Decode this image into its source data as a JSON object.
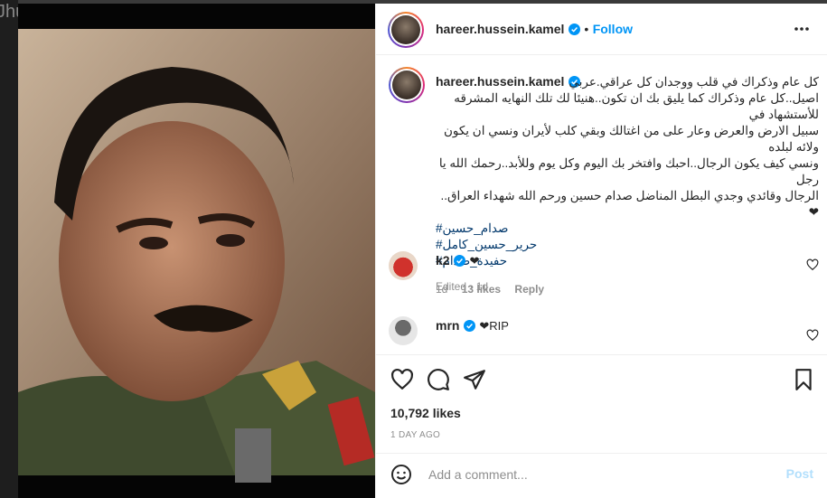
{
  "colors": {
    "accent": "#0095f6",
    "hashtag": "#00376b",
    "muted": "#8e8e8e",
    "post_disabled": "#b2dffc"
  },
  "background": {
    "partial_text": "Jhut"
  },
  "header": {
    "username": "hareer.hussein.kamel",
    "separator": "•",
    "follow_label": "Follow",
    "more_icon": "more-horizontal-icon"
  },
  "caption": {
    "username": "hareer.hussein.kamel",
    "lines": [
      "كل عام وذكراك في قلب ووجدان كل عراقي.عربي",
      "اصيل..كل عام وذكراك كما يليق بك ان تكون..هنيئا لك تلك النهايه المشرقه للأستشهاد في",
      "سبيل الارض والعرض وعار على من اغتالك وبقي كلب لأيران ونسي ان يكون ولائه لبلده",
      "ونسي كيف يكون الرجال..احبك وافتخر بك اليوم وكل يوم وللأبد..رحمك الله يا رجل",
      "الرجال وقائدي وجدي البطل المناضل صدام حسين ورحم الله شهداء العراق..❤"
    ],
    "hashtags": [
      "#صدام_حسين",
      "#حرير_حسين_كامل",
      "#حفيدة_صدام"
    ],
    "edited": "Edited · 1d"
  },
  "comments": [
    {
      "username": "k2",
      "text": "❤",
      "time": "1d",
      "likes": "13 likes",
      "reply": "Reply"
    },
    {
      "username": "mrn",
      "text": "❤RIP"
    }
  ],
  "actions": {
    "like_icon": "heart-icon",
    "comment_icon": "comment-icon",
    "share_icon": "share-icon",
    "save_icon": "bookmark-icon",
    "likes": "10,792 likes",
    "posted": "1 DAY AGO"
  },
  "add_comment": {
    "placeholder": "Add a comment...",
    "post_label": "Post",
    "emoji_icon": "emoji-icon"
  }
}
